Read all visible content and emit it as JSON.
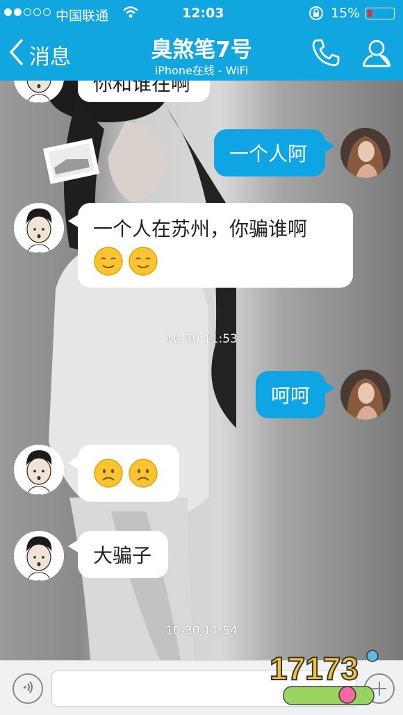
{
  "status_bar": {
    "carrier": "中国联通",
    "time": "12:03",
    "battery": "15%",
    "battery_level": 0.15
  },
  "nav": {
    "back_label": "消息",
    "title": "臭煞笔7号",
    "subtitle": "iPhone在线 - WiFi"
  },
  "messages": [
    {
      "side": "in",
      "text": "你和谁在啊"
    },
    {
      "side": "out",
      "text": "一个人阿"
    },
    {
      "side": "in",
      "text": "一个人在苏州，你骗谁啊"
    },
    {
      "timestamp": "10-30 11:53"
    },
    {
      "side": "out",
      "text": "呵呵"
    },
    {
      "side": "in",
      "text": ""
    },
    {
      "side": "in",
      "text": "大骗子"
    },
    {
      "timestamp": "10-30 11:54"
    }
  ],
  "icons": {
    "back": "chevron-left-icon",
    "phone": "phone-icon",
    "profile": "person-icon",
    "voice": "voice-icon",
    "plus": "plus-icon",
    "smile": "smile-emoji",
    "sad": "sad-emoji"
  },
  "colors": {
    "brand_blue": "#12a6e0",
    "outgoing_bubble": "#0fa5e4",
    "incoming_bubble": "#ffffff",
    "battery_low": "#e03030"
  },
  "watermark": "17173"
}
